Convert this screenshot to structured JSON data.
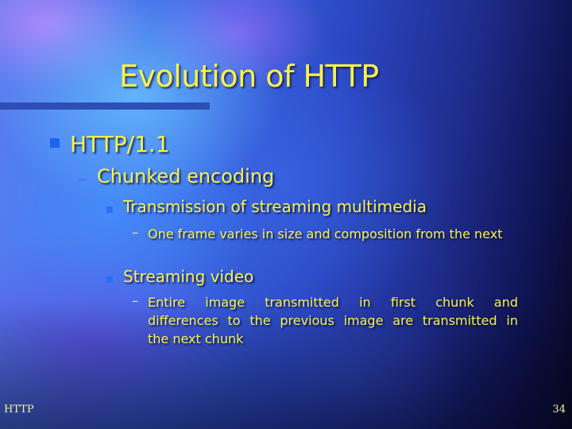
{
  "slide": {
    "title": "Evolution of HTTP",
    "bullets": [
      {
        "text": "HTTP/1.1",
        "icon": "square-bullet-icon",
        "children": [
          {
            "text": "Chunked encoding",
            "icon": "dash-bullet-icon",
            "children": [
              {
                "text": "Transmission of streaming multimedia",
                "icon": "square-bullet-icon",
                "children": [
                  {
                    "text": "One frame varies in size and composition from the next",
                    "icon": "dash-bullet-icon"
                  }
                ]
              },
              {
                "text": "Streaming video",
                "icon": "square-bullet-icon",
                "children": [
                  {
                    "text": "Entire image transmitted in first chunk and differences to the previous image are transmitted in the next chunk",
                    "lines": [
                      "Entire image transmitted in first chunk and",
                      "differences to the previous image are transmitted in",
                      "the next chunk"
                    ],
                    "icon": "dash-bullet-icon"
                  }
                ]
              }
            ]
          }
        ]
      }
    ],
    "dash_glyph": "–"
  },
  "footer": {
    "left": "HTTP",
    "page_number": "34"
  },
  "colors": {
    "text": "#f6f34a",
    "bullet": "#1d63f0",
    "title_rule": "#2d4fb5"
  }
}
